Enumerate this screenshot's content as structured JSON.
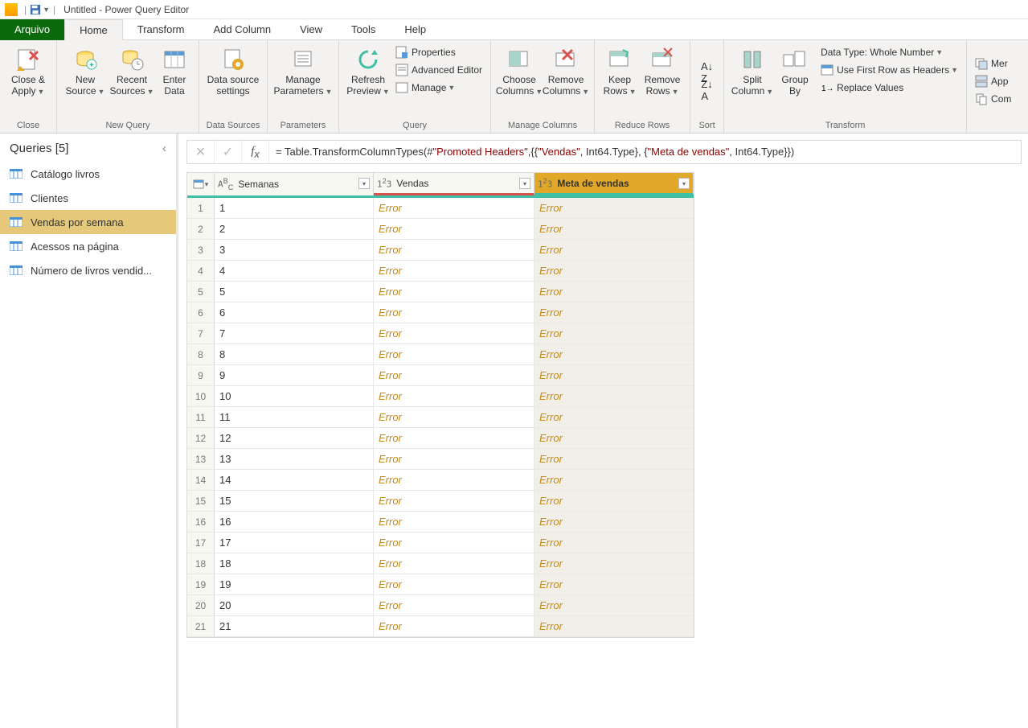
{
  "titlebar": {
    "title": "Untitled - Power Query Editor"
  },
  "tabs": {
    "file": "Arquivo",
    "items": [
      "Home",
      "Transform",
      "Add Column",
      "View",
      "Tools",
      "Help"
    ],
    "active": 0
  },
  "ribbon": {
    "close": {
      "label": "Close &\nApply",
      "group": "Close"
    },
    "newquery": {
      "new_source": "New\nSource",
      "recent_sources": "Recent\nSources",
      "enter_data": "Enter\nData",
      "group": "New Query"
    },
    "datasources": {
      "btn": "Data source\nsettings",
      "group": "Data Sources"
    },
    "parameters": {
      "btn": "Manage\nParameters",
      "group": "Parameters"
    },
    "query": {
      "refresh": "Refresh\nPreview",
      "properties": "Properties",
      "advanced": "Advanced Editor",
      "manage": "Manage",
      "group": "Query"
    },
    "managecols": {
      "choose": "Choose\nColumns",
      "remove": "Remove\nColumns",
      "group": "Manage Columns"
    },
    "reducerows": {
      "keep": "Keep\nRows",
      "remove": "Remove\nRows",
      "group": "Reduce Rows"
    },
    "sort": {
      "group": "Sort"
    },
    "transform": {
      "split": "Split\nColumn",
      "groupby": "Group\nBy",
      "datatype": "Data Type: Whole Number",
      "firstrow": "Use First Row as Headers",
      "replace": "Replace Values",
      "group": "Transform"
    },
    "extra": {
      "merge": "Mer",
      "append": "App",
      "combine": "Com"
    }
  },
  "queries": {
    "header": "Queries [5]",
    "items": [
      "Catálogo livros",
      "Clientes",
      "Vendas por semana",
      "Acessos na página",
      "Número de livros vendid..."
    ],
    "selected": 2
  },
  "formula": {
    "prefix": "= Table.TransformColumnTypes(#",
    "s1": "\"Promoted Headers\"",
    "mid1": ",{{",
    "s2": "\"Vendas\"",
    "mid2": ", Int64.Type}, {",
    "s3": "\"Meta de vendas\"",
    "suffix": ", Int64.Type}})"
  },
  "grid": {
    "columns": [
      {
        "type": "ABC",
        "name": "Semanas"
      },
      {
        "type": "123",
        "name": "Vendas"
      },
      {
        "type": "123",
        "name": "Meta de vendas"
      }
    ],
    "error_text": "Error",
    "rows": [
      "1",
      "2",
      "3",
      "4",
      "5",
      "6",
      "7",
      "8",
      "9",
      "10",
      "11",
      "12",
      "13",
      "14",
      "15",
      "16",
      "17",
      "18",
      "19",
      "20",
      "21"
    ]
  }
}
